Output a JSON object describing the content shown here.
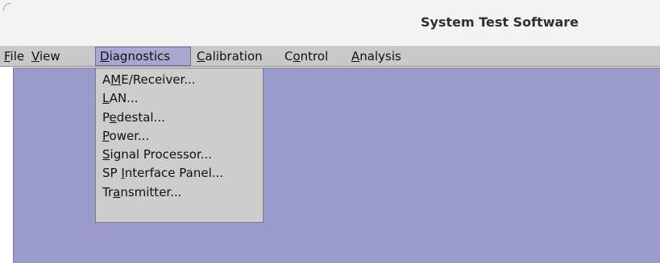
{
  "window": {
    "title": "System Test Software"
  },
  "menubar": {
    "items": [
      {
        "pre": "",
        "key": "F",
        "post": "ile"
      },
      {
        "pre": "",
        "key": "V",
        "post": "iew"
      },
      {
        "pre": "",
        "key": "D",
        "post": "iagnostics"
      },
      {
        "pre": "",
        "key": "C",
        "post": "alibration"
      },
      {
        "pre": "C",
        "key": "o",
        "post": "ntrol"
      },
      {
        "pre": "",
        "key": "A",
        "post": "nalysis"
      }
    ],
    "active": "Diagnostics"
  },
  "diagnostics_menu": {
    "items": [
      {
        "pre": "A",
        "key": "M",
        "post": "E/Receiver..."
      },
      {
        "pre": "",
        "key": "L",
        "post": "AN..."
      },
      {
        "pre": "P",
        "key": "e",
        "post": "destal..."
      },
      {
        "pre": "",
        "key": "P",
        "post": "ower..."
      },
      {
        "pre": "",
        "key": "S",
        "post": "ignal Processor..."
      },
      {
        "pre": "SP ",
        "key": "I",
        "post": "nterface Panel..."
      },
      {
        "pre": "Tr",
        "key": "a",
        "post": "nsmitter..."
      }
    ]
  },
  "colors": {
    "menubar_bg": "#c9c9c9",
    "active_menu_bg": "#a8a8d0",
    "workspace_bg": "#9b9acc",
    "dropdown_bg": "#cdcdcd"
  }
}
